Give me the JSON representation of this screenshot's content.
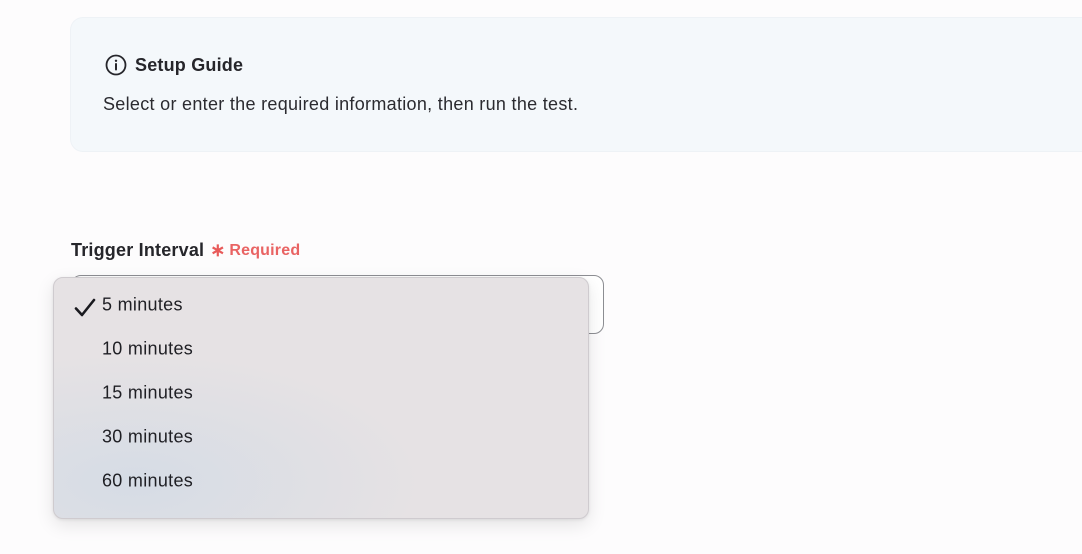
{
  "setup_guide": {
    "icon": "info-icon",
    "title": "Setup Guide",
    "description": "Select or enter the required information, then run the test."
  },
  "field": {
    "label": "Trigger Interval",
    "required_marker": "∗",
    "required_text": "Required"
  },
  "dropdown": {
    "selected": "5 minutes",
    "options": [
      {
        "label": "5 minutes",
        "checked": true
      },
      {
        "label": "10 minutes",
        "checked": false
      },
      {
        "label": "15 minutes",
        "checked": false
      },
      {
        "label": "30 minutes",
        "checked": false
      },
      {
        "label": "60 minutes",
        "checked": false
      }
    ]
  },
  "colors": {
    "required": "#e96363",
    "guide_bg": "#f4f8fb",
    "dropdown_bg": "#e6e2e4"
  }
}
